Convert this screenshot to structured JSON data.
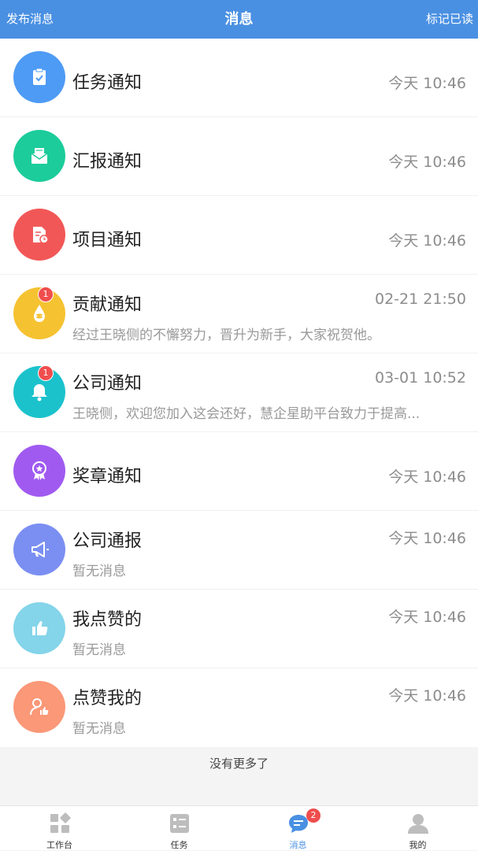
{
  "header": {
    "left": "发布消息",
    "title": "消息",
    "right": "标记已读"
  },
  "items": [
    {
      "name": "任务通知",
      "time": "今天 10:46",
      "sub": "",
      "badge": "",
      "color": "#4e9bf5",
      "icon": "clipboard-check-icon"
    },
    {
      "name": "汇报通知",
      "time": "今天 10:46",
      "sub": "",
      "badge": "",
      "color": "#1ccc9a",
      "icon": "envelope-icon"
    },
    {
      "name": "项目通知",
      "time": "今天 10:46",
      "sub": "",
      "badge": "",
      "color": "#f25757",
      "icon": "document-clock-icon"
    },
    {
      "name": "贡献通知",
      "time": "02-21 21:50",
      "sub": "经过王晓侧的不懈努力，晋升为新手，大家祝贺他。",
      "badge": "1",
      "color": "#f5c231",
      "icon": "coin-drop-icon"
    },
    {
      "name": "公司通知",
      "time": "03-01 10:52",
      "sub": "王晓侧，欢迎您加入这会还好，慧企星助平台致力于提高...",
      "badge": "1",
      "color": "#1bc2cc",
      "icon": "bell-icon"
    },
    {
      "name": "奖章通知",
      "time": "今天 10:46",
      "sub": "",
      "badge": "",
      "color": "#a05af0",
      "icon": "medal-icon"
    },
    {
      "name": "公司通报",
      "time": "今天 10:46",
      "sub": "暂无消息",
      "badge": "",
      "color": "#7b8ff2",
      "icon": "megaphone-icon"
    },
    {
      "name": "我点赞的",
      "time": "今天 10:46",
      "sub": "暂无消息",
      "badge": "",
      "color": "#84d4ea",
      "icon": "thumbs-up-icon"
    },
    {
      "name": "点赞我的",
      "time": "今天 10:46",
      "sub": "暂无消息",
      "badge": "",
      "color": "#fa9878",
      "icon": "user-like-icon"
    }
  ],
  "footer_text": "没有更多了",
  "tabs": [
    {
      "label": "工作台",
      "active": false,
      "badge": ""
    },
    {
      "label": "任务",
      "active": false,
      "badge": ""
    },
    {
      "label": "消息",
      "active": true,
      "badge": "2"
    },
    {
      "label": "我的",
      "active": false,
      "badge": ""
    }
  ],
  "colors": {
    "accent": "#4a90e2",
    "badge": "#f04d4d"
  }
}
